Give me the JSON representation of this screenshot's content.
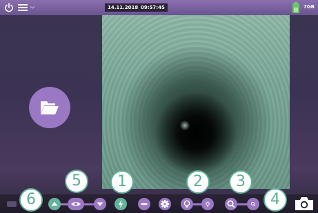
{
  "status": {
    "date": "14.11.2018",
    "time": "09:57:45",
    "storage": "7GB"
  },
  "colors": {
    "accent_purple": "#9a78c4",
    "accent_green": "#64b39e",
    "callout": "#5fae96"
  },
  "callouts": [
    "1",
    "2",
    "3",
    "4",
    "5",
    "6"
  ],
  "icons": {
    "power": "power-icon",
    "menu": "menu-icon",
    "folder": "folder-icon",
    "up": "triangle-up-icon",
    "eye": "eye-icon",
    "down": "triangle-down-icon",
    "flash": "flash-icon",
    "minus": "minus-icon",
    "settings": "gear-icon",
    "light_high": "bulb-large-icon",
    "light_low": "bulb-small-icon",
    "zoom_in": "zoom-large-icon",
    "zoom_out": "zoom-small-icon",
    "camera": "camera-icon"
  }
}
